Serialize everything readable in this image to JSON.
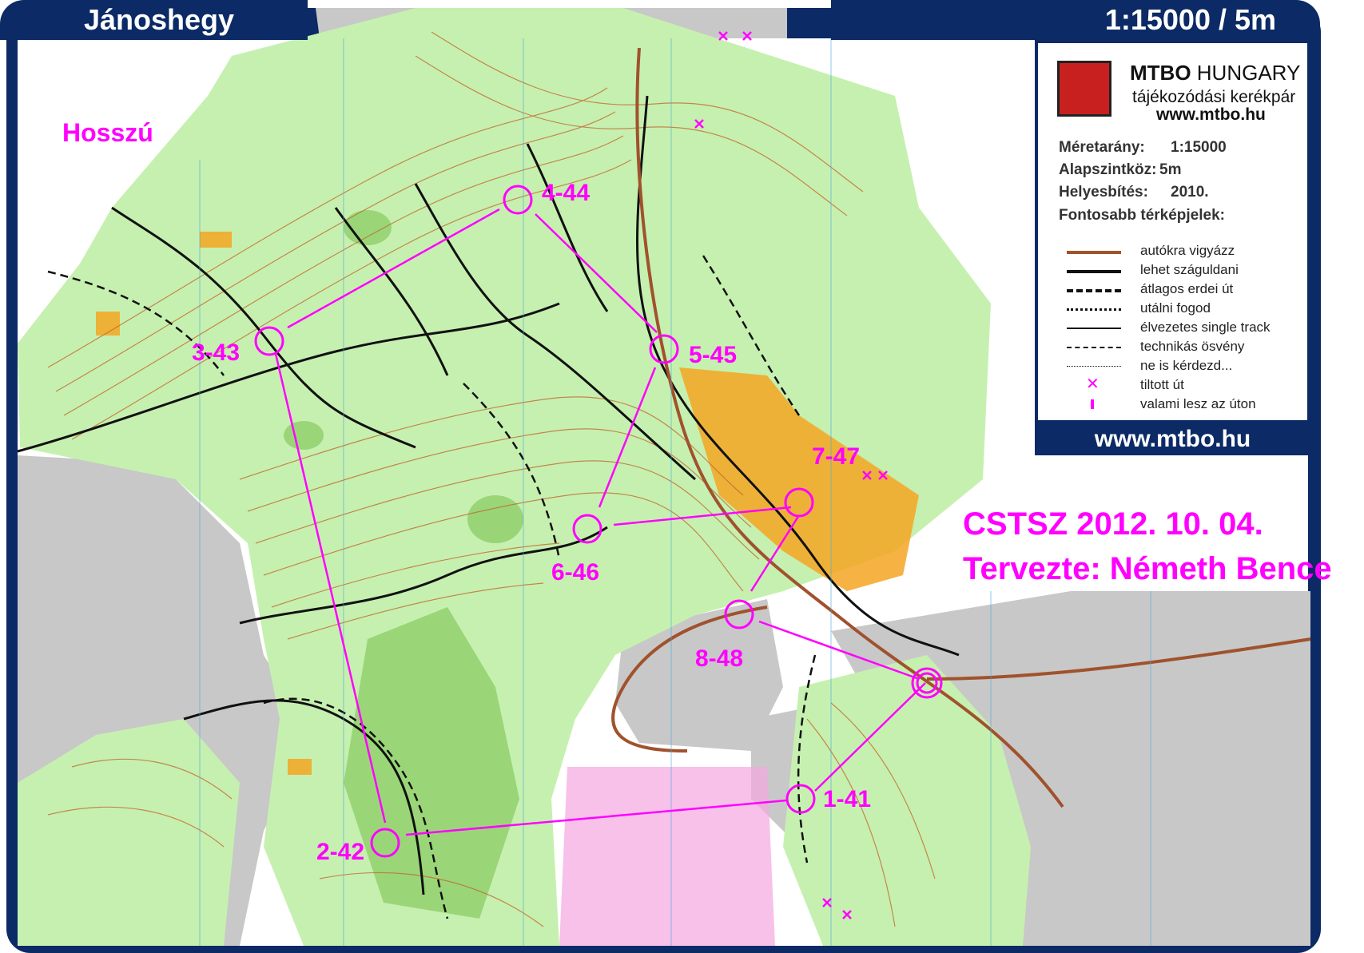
{
  "map": {
    "area_name": "Jánoshegy",
    "scale_header": "1:15000 / 5m",
    "course_name": "Hosszú",
    "colors": {
      "frame": "#0b2a66",
      "course": "#ff00ff",
      "vegetation": "#c6f0b0",
      "open_land": "#f5a623",
      "urban": "#c8c8c8",
      "contour": "#c0652a"
    }
  },
  "controls": [
    {
      "label": "1-41"
    },
    {
      "label": "2-42"
    },
    {
      "label": "3-43"
    },
    {
      "label": "4-44"
    },
    {
      "label": "5-45"
    },
    {
      "label": "6-46"
    },
    {
      "label": "7-47"
    },
    {
      "label": "8-48"
    }
  ],
  "event": {
    "line1": "CSTSZ  2012. 10. 04.",
    "line2": "Tervezte: Németh Bence"
  },
  "legend": {
    "brand_bold": "MTBO",
    "brand_light": " HUNGARY",
    "brand_sub": "tájékozódási kerékpár",
    "brand_url": "www.mtbo.hu",
    "info": [
      {
        "key": "Méretarány:",
        "value": "1:15000"
      },
      {
        "key": "Alapszintköz:",
        "value": "5m"
      },
      {
        "key": "Helyesbítés:",
        "value": "2010."
      }
    ],
    "title": "Fontosabb térképjelek:",
    "items": [
      {
        "label": "autókra vigyázz"
      },
      {
        "label": "lehet száguldani"
      },
      {
        "label": "átlagos erdei út"
      },
      {
        "label": "utálni fogod"
      },
      {
        "label": "élvezetes single track"
      },
      {
        "label": "technikás ösvény"
      },
      {
        "label": "ne is kérdezd..."
      },
      {
        "label": "tiltott út"
      },
      {
        "label": "valami lesz az úton"
      }
    ],
    "footer_url": "www.mtbo.hu"
  }
}
